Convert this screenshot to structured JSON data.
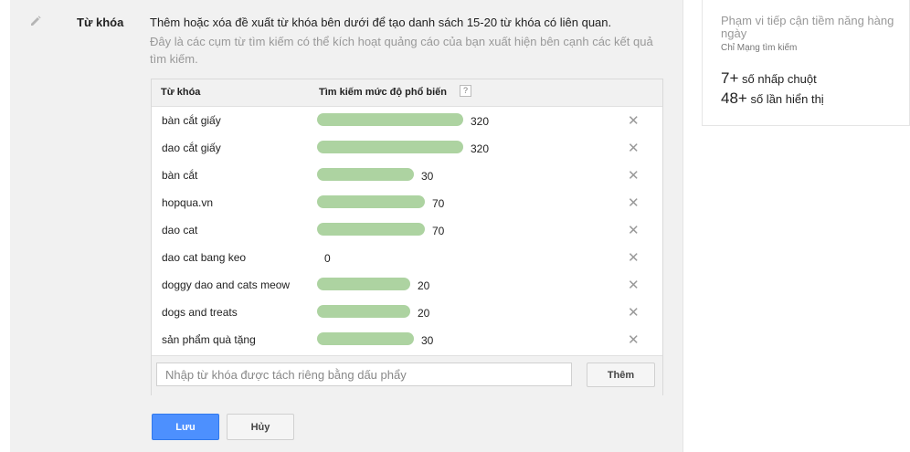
{
  "section": {
    "label": "Từ khóa",
    "description": "Thêm hoặc xóa đề xuất từ khóa bên dưới để tạo danh sách 15-20 từ khóa có liên quan.",
    "hint": "Đây là các cụm từ tìm kiếm có thể kích hoạt quảng cáo của bạn xuất hiện bên cạnh các kết quả tìm kiếm."
  },
  "table": {
    "col_keyword": "Từ khóa",
    "col_popularity": "Tìm kiếm mức độ phổ biến",
    "help_icon": "?",
    "remove_glyph": "✕",
    "rows": [
      {
        "keyword": "bàn cắt giấy",
        "popularity": 320,
        "label": "320"
      },
      {
        "keyword": "dao cắt giấy",
        "popularity": 320,
        "label": "320"
      },
      {
        "keyword": "bàn cắt",
        "popularity": 30,
        "label": "30"
      },
      {
        "keyword": "hopqua.vn",
        "popularity": 70,
        "label": "70"
      },
      {
        "keyword": "dao cat",
        "popularity": 70,
        "label": "70"
      },
      {
        "keyword": "dao cat bang keo",
        "popularity": 0,
        "label": "0"
      },
      {
        "keyword": "doggy dao and cats meow",
        "popularity": 20,
        "label": "20"
      },
      {
        "keyword": "dogs and treats",
        "popularity": 20,
        "label": "20"
      },
      {
        "keyword": "sản phẩm quà tặng",
        "popularity": 30,
        "label": "30"
      }
    ],
    "input_placeholder": "Nhập từ khóa được tách riêng bằng dấu phẩy",
    "input_value": "",
    "add_label": "Thêm"
  },
  "actions": {
    "save_label": "Lưu",
    "cancel_label": "Hủy"
  },
  "sidebar": {
    "title": "Phạm vi tiếp cận tiềm năng hàng ngày",
    "subtitle": "Chỉ Mạng tìm kiếm",
    "clicks_value": "7+",
    "clicks_label": "số nhấp chuột",
    "impressions_value": "48+",
    "impressions_label": "số lần hiển thị"
  },
  "colors": {
    "bar": "#add3a1",
    "primary_button": "#4d90fe",
    "panel_bg": "#f1f1f1"
  },
  "icons": {
    "edit": "pencil-icon",
    "remove": "close-icon",
    "help": "help-icon"
  }
}
